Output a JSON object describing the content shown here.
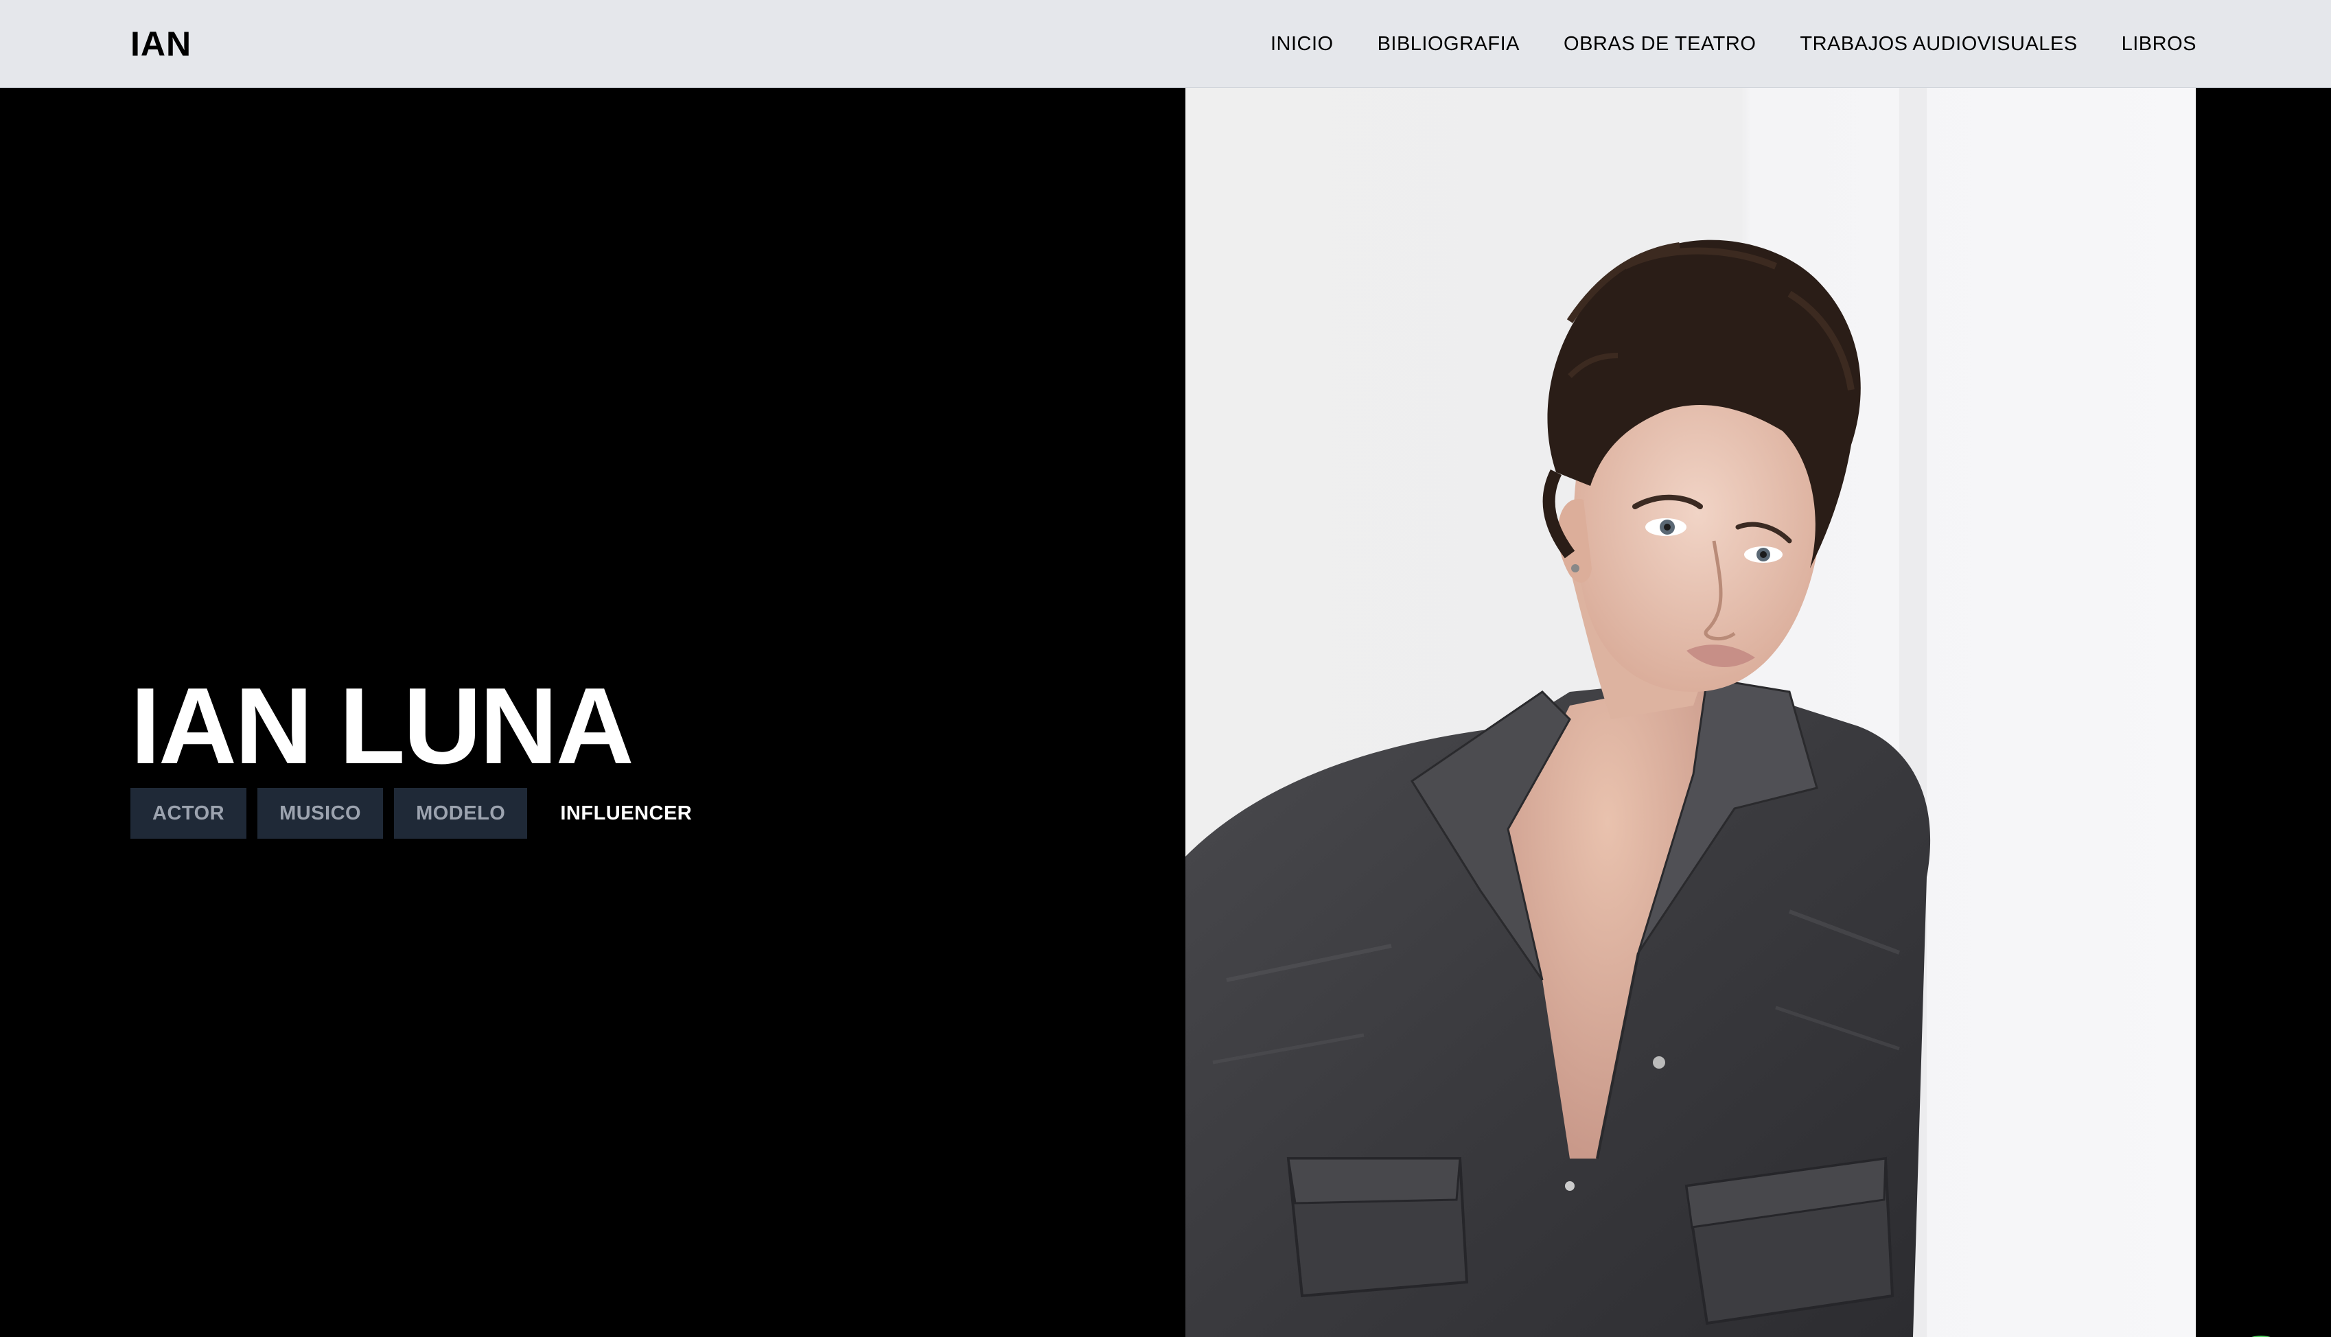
{
  "header": {
    "logo": "IAN",
    "menu": [
      {
        "label": "INICIO"
      },
      {
        "label": "BIBLIOGRAFIA"
      },
      {
        "label": "OBRAS DE TEATRO"
      },
      {
        "label": "TRABAJOS AUDIOVISUALES"
      },
      {
        "label": "LIBROS"
      }
    ]
  },
  "hero": {
    "title": "IAN LUNA",
    "tags": [
      {
        "label": "ACTOR"
      },
      {
        "label": "MUSICO"
      },
      {
        "label": "MODELO"
      },
      {
        "label": "INFLUENCER"
      }
    ]
  },
  "toolbar": {
    "icons": [
      "comment-icon",
      "eye-icon",
      "list-icon"
    ]
  },
  "floating_action": {
    "icon": "whatsapp-icon",
    "color": "#4fce5d"
  },
  "colors": {
    "nav_background": "#e5e7eb",
    "hero_background": "#000000",
    "tag_background": "#1f2937",
    "tag_text": "#9ca3af"
  }
}
